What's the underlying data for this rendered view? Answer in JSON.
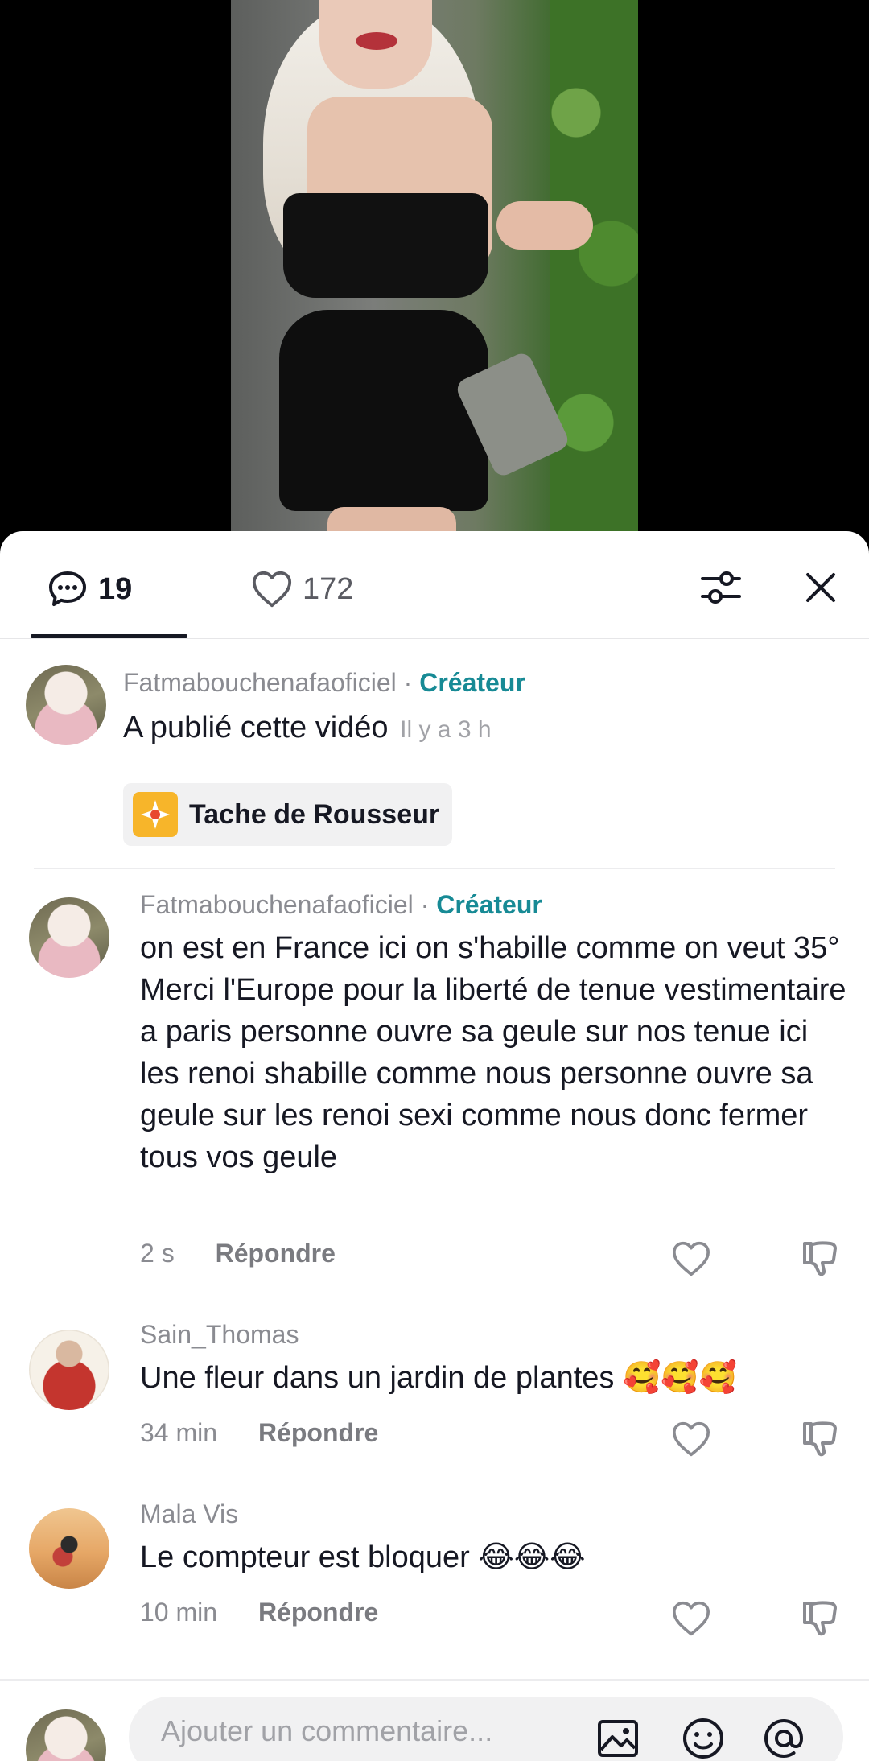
{
  "tabs": {
    "comments_count": "19",
    "likes_count": "172"
  },
  "post": {
    "username": "Fatmabouchenafaoficiel",
    "separator": "·",
    "creator_label": "Créateur",
    "text": "A publié cette vidéo",
    "time": "Il y a 3 h",
    "sticker_label": "Tache de Rousseur"
  },
  "comments": [
    {
      "username": "Fatmabouchenafaoficiel",
      "separator": "·",
      "creator_label": "Créateur",
      "text": "on est en France ici on s'habille comme on veut 35° Merci l'Europe pour la liberté de tenue vestimentaire a paris personne ouvre sa geule sur nos tenue ici les renoi shabille comme nous personne ouvre sa geule sur les renoi sexi comme nous donc fermer tous vos geule",
      "time": "2 s",
      "reply": "Répondre"
    },
    {
      "username": "Sain_Thomas",
      "text": "Une fleur dans un jardin de plantes 🥰🥰🥰",
      "time": "34 min",
      "reply": "Répondre"
    },
    {
      "username": "Mala Vis",
      "text": "Le compteur est bloquer 😂😂😂",
      "time": "10 min",
      "reply": "Répondre"
    }
  ],
  "composer": {
    "placeholder": "Ajouter un commentaire..."
  },
  "icons": {
    "comment": "comment-bubble-icon",
    "like": "heart-icon",
    "filter": "sliders-icon",
    "close": "close-icon",
    "dislike": "thumbs-down-icon",
    "image": "image-icon",
    "emoji": "emoji-icon",
    "mention": "at-icon"
  },
  "colors": {
    "creator": "#178a95",
    "text": "#161823",
    "muted": "#8a8b91",
    "sticker": "#f7b52a"
  }
}
